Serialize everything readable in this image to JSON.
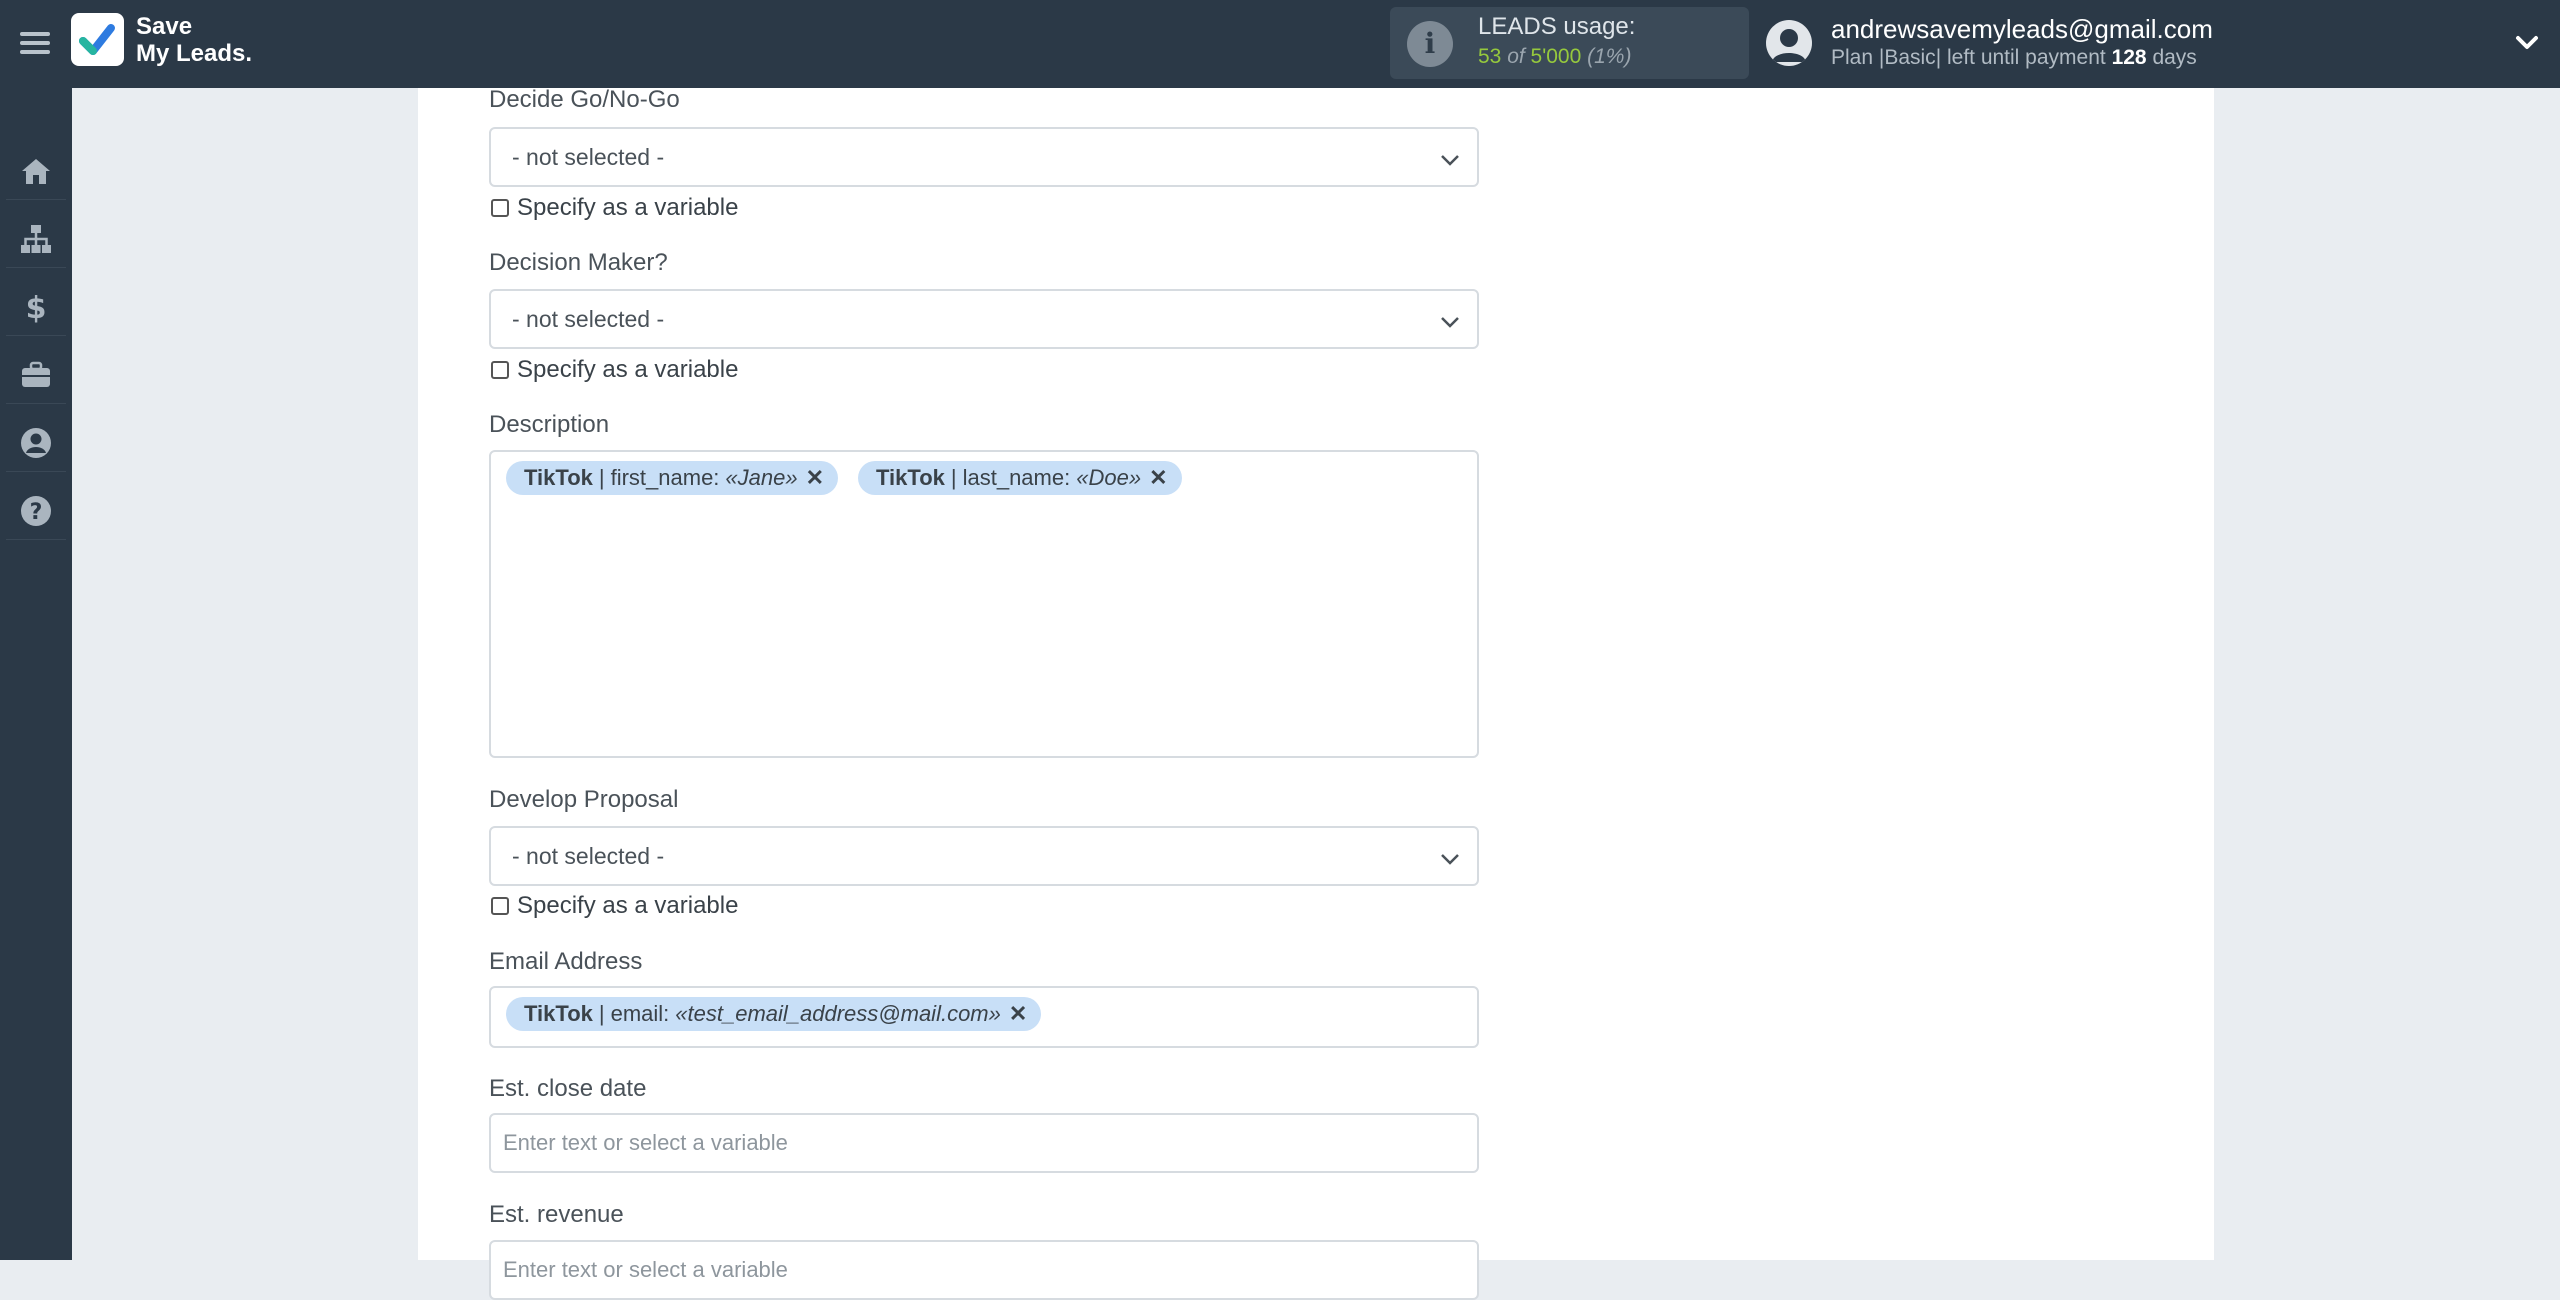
{
  "header": {
    "brand_line1": "Save",
    "brand_line2": "My Leads.",
    "usage": {
      "title": "LEADS usage:",
      "used": "53",
      "of": " of ",
      "limit": "5'000",
      "percent": " (1%)"
    },
    "user": {
      "email": "andrewsavemyleads@gmail.com",
      "plan_prefix": "Plan |",
      "plan_name": "Basic",
      "plan_middle": "| left until payment ",
      "days": "128",
      "days_suffix": " days"
    }
  },
  "sidebar": {
    "items": [
      {
        "icon": "home-icon"
      },
      {
        "icon": "sitemap-icon"
      },
      {
        "icon": "dollar-icon"
      },
      {
        "icon": "briefcase-icon"
      },
      {
        "icon": "user-circle-icon"
      },
      {
        "icon": "question-circle-icon"
      }
    ]
  },
  "form": {
    "decide_go": {
      "label": "Decide Go/No-Go",
      "value": "- not selected -",
      "checkbox_label": "Specify as a variable"
    },
    "decision_maker": {
      "label": "Decision Maker?",
      "value": "- not selected -",
      "checkbox_label": "Specify as a variable"
    },
    "description": {
      "label": "Description",
      "tags": [
        {
          "source": "TikTok",
          "separator": "|",
          "field": "first_name:",
          "value": "«Jane»"
        },
        {
          "source": "TikTok",
          "separator": "|",
          "field": "last_name:",
          "value": "«Doe»"
        }
      ]
    },
    "develop_proposal": {
      "label": "Develop Proposal",
      "value": "- not selected -",
      "checkbox_label": "Specify as a variable"
    },
    "email_address": {
      "label": "Email Address",
      "tags": [
        {
          "source": "TikTok",
          "separator": "|",
          "field": "email:",
          "value": "«test_email_address@mail.com»"
        }
      ]
    },
    "est_close_date": {
      "label": "Est. close date",
      "placeholder": "Enter text or select a variable"
    },
    "est_revenue": {
      "label": "Est. revenue",
      "placeholder": "Enter text or select a variable"
    }
  },
  "colors": {
    "topbar": "#2b3947",
    "accent_green": "#96c93d",
    "tag_bg": "#c8dff7",
    "logo_check": "#2e7be0"
  }
}
